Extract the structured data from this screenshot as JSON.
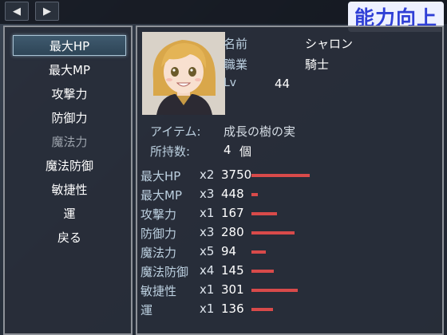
{
  "nav": {
    "prev_label": "◀",
    "next_label": "▶"
  },
  "title": "能力向上",
  "commands": [
    {
      "label": "最大HP",
      "state": "selected"
    },
    {
      "label": "最大MP",
      "state": "normal"
    },
    {
      "label": "攻撃力",
      "state": "normal"
    },
    {
      "label": "防御力",
      "state": "normal"
    },
    {
      "label": "魔法力",
      "state": "disabled"
    },
    {
      "label": "魔法防御",
      "state": "normal"
    },
    {
      "label": "敏捷性",
      "state": "normal"
    },
    {
      "label": "運",
      "state": "normal"
    },
    {
      "label": "戻る",
      "state": "normal"
    }
  ],
  "actor": {
    "name_label": "名前",
    "name": "シャロン",
    "class_label": "職業",
    "class": "騎士",
    "level_label": "Lv",
    "level": "44"
  },
  "item": {
    "item_label": "アイテム:",
    "item_name": "成長の樹の実",
    "count_label": "所持数:",
    "count_value": "4",
    "count_unit": "個"
  },
  "stats": [
    {
      "name": "最大HP",
      "mult": "x2",
      "value": "3750",
      "bar": 0.96
    },
    {
      "name": "最大MP",
      "mult": "x3",
      "value": "448",
      "bar": 0.11
    },
    {
      "name": "攻撃力",
      "mult": "x1",
      "value": "167",
      "bar": 0.42
    },
    {
      "name": "防御力",
      "mult": "x3",
      "value": "280",
      "bar": 0.71
    },
    {
      "name": "魔法力",
      "mult": "x5",
      "value": "94",
      "bar": 0.24
    },
    {
      "name": "魔法防御",
      "mult": "x4",
      "value": "145",
      "bar": 0.37
    },
    {
      "name": "敏捷性",
      "mult": "x1",
      "value": "301",
      "bar": 0.76
    },
    {
      "name": "運",
      "mult": "x1",
      "value": "136",
      "bar": 0.35
    }
  ],
  "colors": {
    "bar": "#d84a4a",
    "title_text": "#2f3fd6",
    "title_bg": "#eef1ff"
  },
  "icons": {
    "prev": "chevron-left-icon",
    "next": "chevron-right-icon"
  }
}
